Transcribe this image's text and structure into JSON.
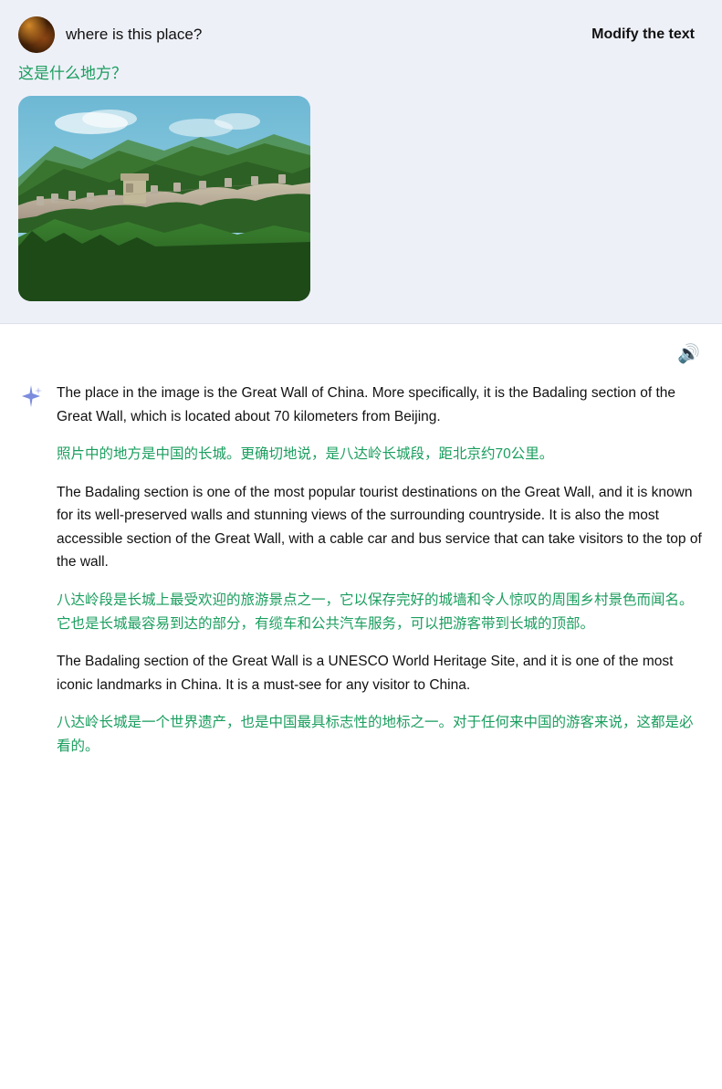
{
  "question": {
    "text": "where is this place?",
    "chinese_text": "这是什么地方？",
    "avatar_alt": "user avatar"
  },
  "modify_button": {
    "label": "Modify the text"
  },
  "answer": {
    "paragraph1_en": "The place in the image is the Great Wall of China. More specifically, it is the Badaling section of the Great Wall, which is located about 70 kilometers from Beijing.",
    "paragraph1_zh": "照片中的地方是中国的长城。更确切地说，是八达岭长城段，距北京约70公里。",
    "paragraph2_en": "The Badaling section is one of the most popular tourist destinations on the Great Wall, and it is known for its well-preserved walls and stunning views of the surrounding countryside. It is also the most accessible section of the Great Wall, with a cable car and bus service that can take visitors to the top of the wall.",
    "paragraph2_zh": "八达岭段是长城上最受欢迎的旅游景点之一，它以保存完好的城墙和令人惊叹的周围乡村景色而闻名。它也是长城最容易到达的部分，有缆车和公共汽车服务，可以把游客带到长城的顶部。",
    "paragraph3_en": "The Badaling section of the Great Wall is a UNESCO World Heritage Site, and it is one of the most iconic landmarks in China. It is a must-see for any visitor to China.",
    "paragraph3_zh": "八达岭长城是一个世界遗产，也是中国最具标志性的地标之一。对于任何来中国的游客来说，这都是必看的。"
  },
  "icons": {
    "speaker": "🔊",
    "sparkle": "✦"
  },
  "colors": {
    "green": "#1a9e5e",
    "text": "#111111",
    "bg_question": "#eef0f8",
    "bg_answer": "#ffffff"
  }
}
